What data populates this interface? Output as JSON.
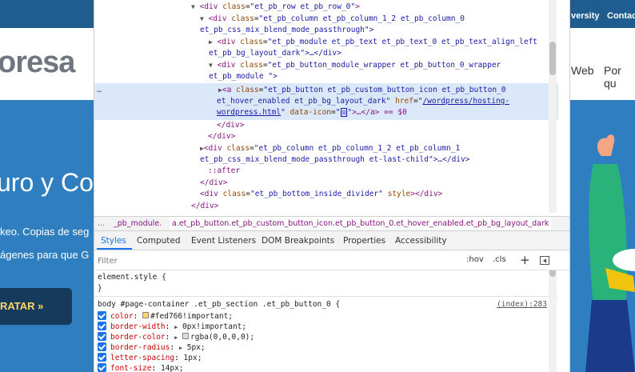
{
  "site": {
    "topbar_links": [
      "versity",
      "Contac"
    ],
    "logo_text": "oresa",
    "menu_items": [
      "Web",
      "Por qu"
    ],
    "hero_title": "uro y Co",
    "hero_lines": [
      "keo. Copias de seg",
      "ágenes para que G"
    ],
    "hero_button": "RATAR »",
    "colors": {
      "topbar": "#1f5c8f",
      "hero": "#2f7fc0",
      "button_bg": "#163a5c",
      "button_text": "#fed766"
    }
  },
  "devtools": {
    "elements": {
      "more_indicator": "…",
      "lines": [
        {
          "indent": 0,
          "tri": "▼",
          "tag": "div",
          "attrs": [
            [
              "class",
              "et_pb_row et_pb_row_0"
            ]
          ],
          "close": ">"
        },
        {
          "indent": 1,
          "tri": "▼",
          "tag": "div",
          "attrs": [
            [
              "class",
              "et_pb_column et_pb_column_1_2 et_pb_column_0"
            ]
          ],
          "close": ""
        },
        {
          "indent": 1,
          "cont": "et_pb_css_mix_blend_mode_passthrough\">"
        },
        {
          "indent": 2,
          "tri": "▶",
          "tag": "div",
          "attrs": [
            [
              "class",
              "et_pb_module et_pb_text et_pb_text_0  et_pb_text_align_left"
            ]
          ],
          "close": ""
        },
        {
          "indent": 2,
          "cont": "et_pb_bg_layout_dark\">…</div>"
        },
        {
          "indent": 2,
          "tri": "▼",
          "tag": "div",
          "attrs": [
            [
              "class",
              "et_pb_button_module_wrapper et_pb_button_0_wrapper"
            ]
          ],
          "close": ""
        },
        {
          "indent": 2,
          "cont": "et_pb_module \">"
        }
      ],
      "selected": {
        "line1_tag": "a",
        "line1_class": "et_pb_button et_pb_custom_button_icon et_pb_button_0",
        "line2_class": "et_hover_enabled et_pb_bg_layout_dark",
        "href_name": "href",
        "href_value": "/wordpress/hosting-",
        "line3_href": "wordpress.html",
        "data_icon_name": "data-icon",
        "data_icon_value": "",
        "line3_tail": ">…</a> == $0"
      },
      "after_lines": [
        "</div>",
        "</div>",
        "et_pb_column et_pb_column_1_2 et_pb_column_1",
        "et_pb_css_mix_blend_mode_passthrough et-last-child\">…</div>",
        "::after",
        "</div>",
        "et_pb_bottom_inside_divider",
        "</div>"
      ]
    },
    "breadcrumbs": {
      "dots": "...",
      "first": "_pb_module.",
      "active": "a.et_pb_button.et_pb_custom_button_icon.et_pb_button_0.et_hover_enabled.et_pb_bg_layout_dark"
    },
    "tabs": [
      "Styles",
      "Computed",
      "Event Listeners",
      "DOM Breakpoints",
      "Properties",
      "Accessibility"
    ],
    "active_tab": "Styles",
    "filter": {
      "placeholder": "Filter",
      "value": "",
      "hov": ":hov",
      "cls": ".cls"
    },
    "styles": {
      "element_style_open": "element.style {",
      "element_style_close": "}",
      "rule_selector": "body #page-container .et_pb_section .et_pb_button_0 {",
      "rule_source": "(index):283",
      "props": [
        {
          "name": "color",
          "value": "#fed766!important;",
          "swatch": "#fed766",
          "expand": false
        },
        {
          "name": "border-width",
          "value": "0px!important;",
          "swatch": "",
          "expand": true
        },
        {
          "name": "border-color",
          "value": "rgba(0,0,0,0);",
          "swatch": "rgba(0,0,0,0)",
          "expand": true
        },
        {
          "name": "border-radius",
          "value": "5px;",
          "swatch": "",
          "expand": true
        },
        {
          "name": "letter-spacing",
          "value": "1px;",
          "swatch": "",
          "expand": false
        },
        {
          "name": "font-size",
          "value": "14px;",
          "swatch": "",
          "expand": false
        }
      ]
    }
  }
}
